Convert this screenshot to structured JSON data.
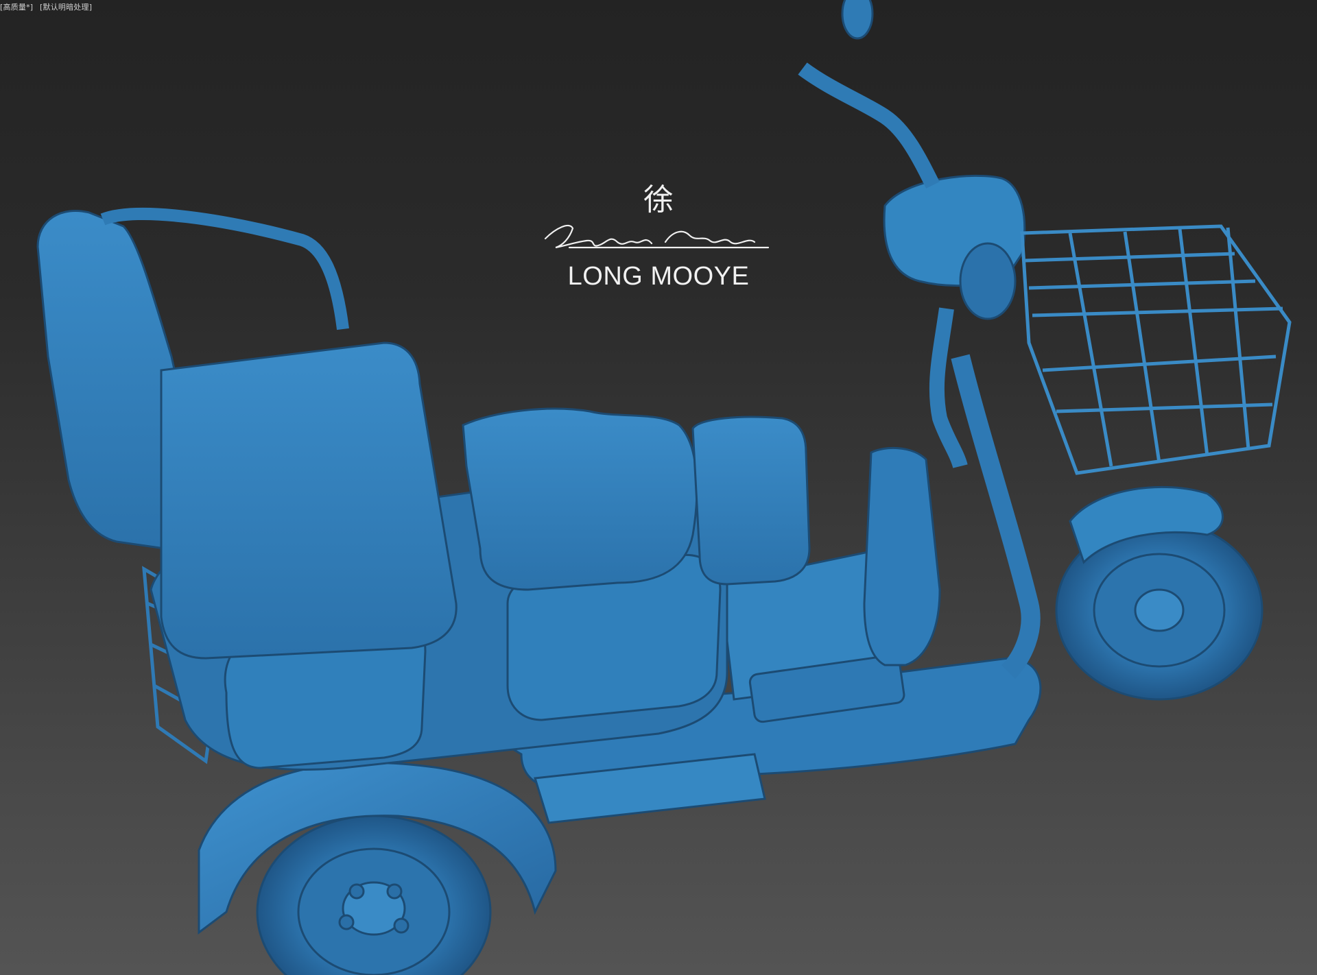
{
  "viewport": {
    "label_left": "[+]",
    "label_mode": "[默认明暗处理]",
    "label_quality": "[高质量*]"
  },
  "watermark": {
    "character": "徐",
    "signature": "Long Mooye",
    "name": "LONG MOOYE"
  },
  "colors": {
    "model": "#2e78b2",
    "model_light": "#3c8fcb",
    "model_dark": "#1d4f78",
    "background_top": "#232323",
    "background_bottom": "#545454"
  }
}
